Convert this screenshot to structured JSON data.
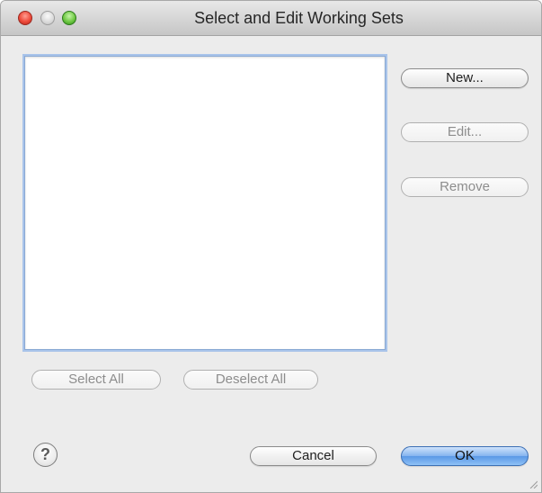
{
  "window": {
    "title": "Select and Edit Working Sets"
  },
  "working_sets_list": {
    "items": []
  },
  "side_buttons": {
    "new_label": "New...",
    "edit_label": "Edit...",
    "remove_label": "Remove"
  },
  "selection_buttons": {
    "select_all_label": "Select All",
    "deselect_all_label": "Deselect All"
  },
  "footer": {
    "help_symbol": "?",
    "cancel_label": "Cancel",
    "ok_label": "OK"
  },
  "icons": {
    "close": "close-icon",
    "minimize": "minimize-icon",
    "zoom": "zoom-icon",
    "help": "help-icon",
    "resize": "resize-grip-icon"
  },
  "colors": {
    "default_button": "#5a98e6",
    "focus_ring": "#a9c4ea",
    "close_button": "#ee4a3a",
    "zoom_button": "#6fc844"
  }
}
